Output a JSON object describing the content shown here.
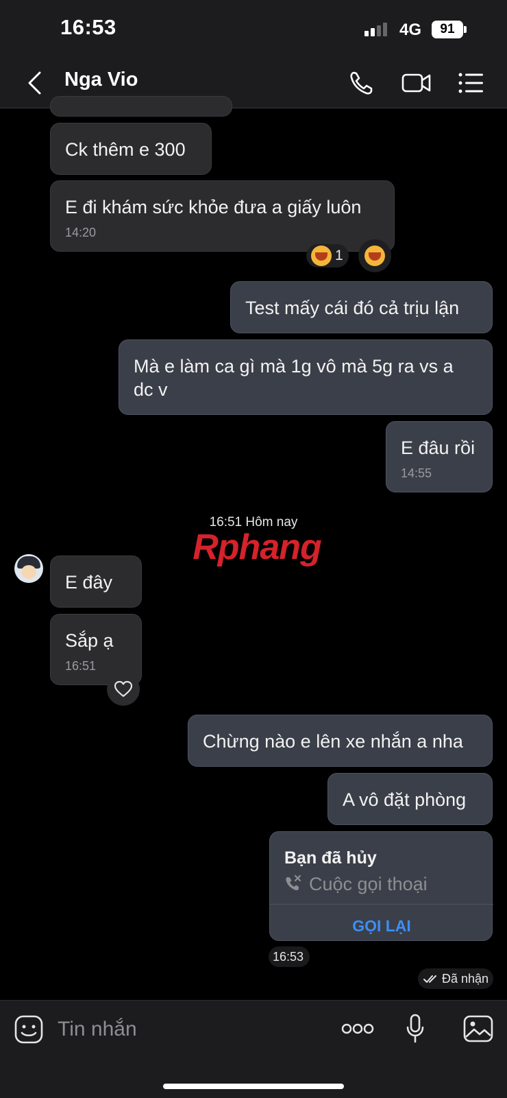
{
  "status_bar": {
    "time": "16:53",
    "network": "4G",
    "battery": "91"
  },
  "header": {
    "contact_name": "Nga Vio"
  },
  "messages": [
    {
      "text": "Ck thêm e 300"
    },
    {
      "text": "E đi khám sức khỏe đưa a giấy luôn",
      "time": "14:20",
      "reaction_count": "1"
    },
    {
      "text": "Test mấy cái đó cả trịu lận"
    },
    {
      "text_line1": "Mà e làm ca gì mà 1g vô mà 5g ra vs a",
      "text_line2": "dc v"
    },
    {
      "text": "E đâu rồi",
      "time": "14:55"
    },
    {
      "text": "E đây"
    },
    {
      "text": "Sắp ạ",
      "time": "16:51"
    },
    {
      "text": "Chừng nào e lên xe nhắn a nha"
    },
    {
      "text": "A vô đặt phòng"
    }
  ],
  "date_separator": "16:51 Hôm nay",
  "watermark": "Rphang",
  "call_card": {
    "title": "Bạn đã hủy",
    "subtitle": "Cuộc gọi thoại",
    "button": "GỌI LẠI",
    "time": "16:53"
  },
  "receipt": "Đã nhận",
  "composer": {
    "placeholder": "Tin nhắn"
  },
  "colors": {
    "accent": "#3d8ef5",
    "incoming_bubble": "#2c2c2e",
    "outgoing_bubble": "#3b3f49"
  }
}
